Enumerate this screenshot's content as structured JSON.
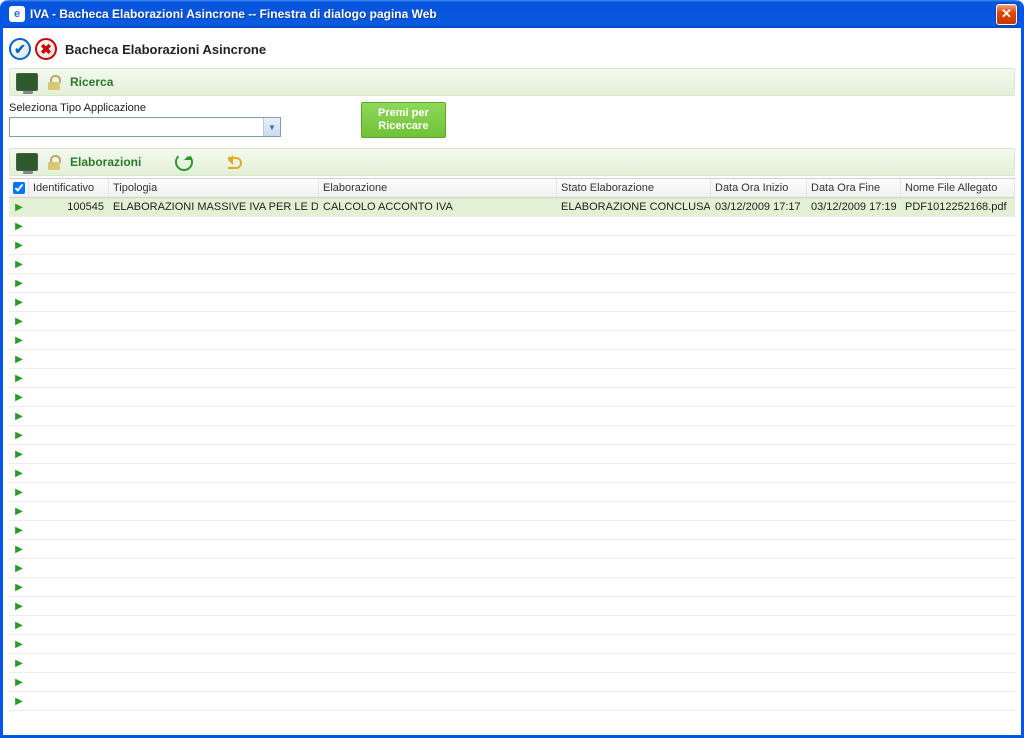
{
  "window": {
    "title": "IVA - Bacheca Elaborazioni Asincrone -- Finestra di dialogo pagina Web"
  },
  "page": {
    "heading": "Bacheca Elaborazioni Asincrone"
  },
  "sections": {
    "ricerca_label": "Ricerca",
    "elaborazioni_label": "Elaborazioni"
  },
  "search": {
    "field_label": "Seleziona Tipo Applicazione",
    "dropdown_value": "",
    "button_line1": "Premi per",
    "button_line2": "Ricercare"
  },
  "table": {
    "headers": {
      "identificativo": "Identificativo",
      "tipologia": "Tipologia",
      "elaborazione": "Elaborazione",
      "stato": "Stato Elaborazione",
      "inizio": "Data Ora Inizio",
      "fine": "Data Ora Fine",
      "file": "Nome File Allegato"
    },
    "rows": [
      {
        "id": "100545",
        "tipologia": "ELABORAZIONI MASSIVE IVA PER LE DITTE",
        "elaborazione": "CALCOLO ACCONTO IVA",
        "stato": "ELABORAZIONE CONCLUSA",
        "inizio": "03/12/2009 17:17",
        "fine": "03/12/2009 17:19",
        "file": "PDF1012252168.pdf"
      }
    ],
    "empty_row_count": 26
  }
}
